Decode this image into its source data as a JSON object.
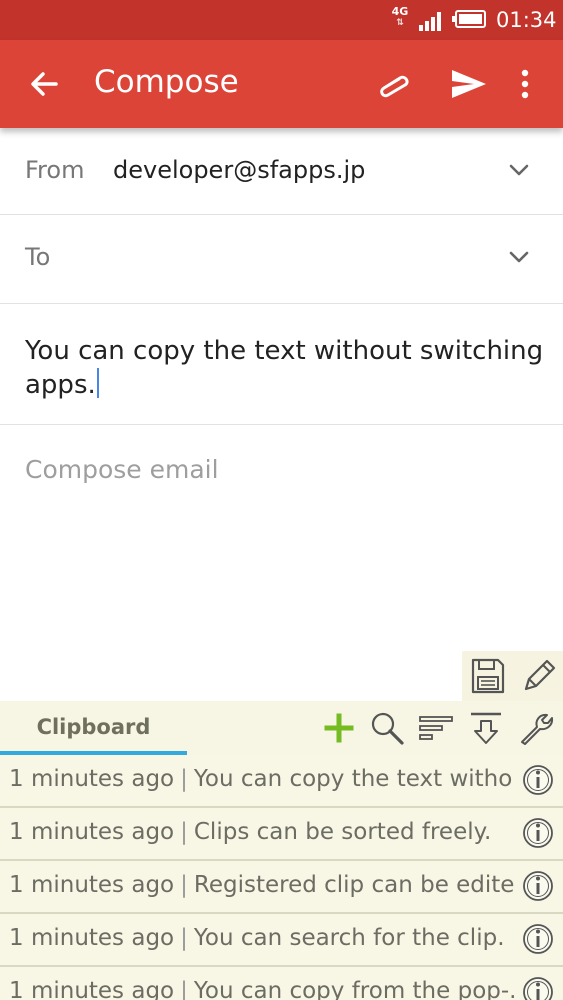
{
  "status_bar": {
    "network": "4G",
    "time": "01:34"
  },
  "app_bar": {
    "title": "Compose",
    "icons": [
      "back-arrow-icon",
      "attach-icon",
      "send-icon",
      "more-vert-icon"
    ]
  },
  "compose": {
    "from_label": "From",
    "from_value": "developer@sfapps.jp",
    "to_label": "To",
    "subject_text": "You can copy the text without switching apps.",
    "body_placeholder": "Compose email"
  },
  "clipboard": {
    "tab_label": "Clipboard",
    "accent_color": "#33aadd",
    "add_color": "#77bb22",
    "items": [
      {
        "time": "1 minutes ago",
        "text": "You can copy the text witho..."
      },
      {
        "time": "1 minutes ago",
        "text": "Clips can be sorted freely."
      },
      {
        "time": "1 minutes ago",
        "text": "Registered clip can be edite..."
      },
      {
        "time": "1 minutes ago",
        "text": "You can search for the clip."
      },
      {
        "time": "1 minutes ago",
        "text": "You can copy from the pop-..."
      }
    ]
  },
  "colors": {
    "status_bar": "#c2332b",
    "app_bar": "#dc4437"
  }
}
